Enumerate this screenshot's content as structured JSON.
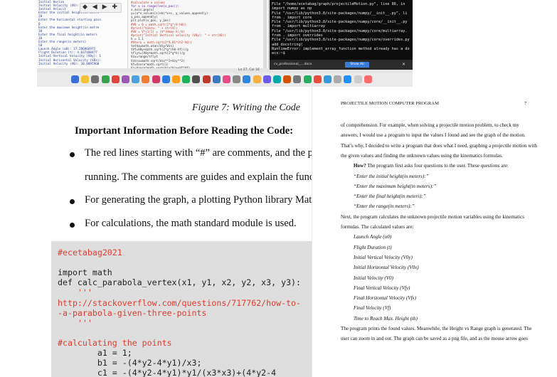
{
  "screenshot": {
    "ide_output_lines": [
      "Initial Horizo",
      "Initial Velocity (V0): Initial Velo",
      "Initial Velocit",
      "",
      "Enter the initial height(in metre",
      "20",
      "Enter the horizontal starting poin",
      "0",
      "Enter the maximum height(in metre",
      "30",
      "Enter the final height(in meters",
      "10",
      "Enter the range(in meters)",
      "50",
      "Launch Angle (α0): 37.286966971",
      "Flight Duration (t): 4.037408477",
      "Initial Vertical Velocity (V0y): 1",
      "Initial Horizontal Velocity (V0x):",
      "Initial Velocity (V0): 30.8095960"
    ],
    "ide_code_lines": [
      {
        "t": "#calculate a values",
        "k": "cm"
      },
      {
        "t": "for x in range(len(x_pos)):",
        "k": "kw"
      },
      {
        "t": "    x_axis.pop(x)",
        "k": ""
      },
      {
        "t": "    y=(a*x_values[x]+b)*x+c, y_values.append(y)",
        "k": ""
      },
      {
        "t": "",
        "k": ""
      },
      {
        "t": "    y_pos.append(y)",
        "k": ""
      },
      {
        "t": "plt.plot(x_pos, y_pos)",
        "k": ""
      },
      {
        "t": "#V0 = 0 = math.sqrt(2*g*(H-h0))",
        "k": "cm"
      },
      {
        "t": "#print(\"Vzero: \" + str(V))",
        "k": "cm"
      },
      {
        "t": "#V0 = V*(1/1) = (V*(Hmax-h)/h)",
        "k": "cm"
      },
      {
        "t": "#print(\"Initial Vertical velocity (V0y): \" + str(V0))",
        "k": "cm"
      },
      {
        "t": "h = 1.1",
        "k": ""
      },
      {
        "t": "#Vzero = math.sqrt(2*9.81*(h2-h0))",
        "k": "cm"
      },
      {
        "t": "tetha=math.atan(Vzy/Vzx)",
        "k": ""
      },
      {
        "t": "tVf=V0y+math.sqrt(2*g*(h0-hf))/g",
        "k": ""
      },
      {
        "t": "tflyt=(V0y+math.sqrt(2*g*h))/g",
        "k": ""
      },
      {
        "t": "Vzx=range/tflyt",
        "k": ""
      },
      {
        "t": "Vzero=math.sqrt(Vzx**2+Vzy**2)",
        "k": ""
      },
      {
        "t": "Vf=Vzero*math.sqrt(1)",
        "k": ""
      },
      {
        "t": "Vz=Vzero*math.sqrt(Vzx*Vzx+Vf*Vf)",
        "k": ""
      }
    ],
    "ide_nav_glyphs": "◆ ◀ ▶ ✚",
    "clock": "Ln 27, Col 16",
    "terminal_lines": [
      "File \"/home/ecetabag/graph/projectileMotion.py\", line 86, in",
      "  import numpy as np",
      "File \"/usr/lib/python3.8/site-packages/numpy/__init__.py\", li",
      "  from . import core",
      "File \"/usr/lib/python3.8/site-packages/numpy/core/__init__.py",
      "  from . import multiarray",
      "File \"/usr/lib/python3.8/site-packages/numpy/core/multiarray.",
      "  from . import overrides",
      "File \"/usr/lib/python3.8/site-packages/numpy/core/overrides.py",
      "  add_docstring(",
      "RuntimeError: implement_array_function method already has a do",
      "ecx:~$"
    ],
    "notification": {
      "file": "cv_professional_....docx",
      "button": "Show All",
      "close": "✕"
    },
    "dock_colors": [
      "#3b6fd8",
      "#f3c13a",
      "#6e6e6e",
      "#37a34a",
      "#e2423c",
      "#9b59b6",
      "#4aa3df",
      "#f07c2d",
      "#d03b6a",
      "#2d7be0",
      "#ff9f1a",
      "#1fb05a",
      "#505050",
      "#c0392b",
      "#3a78c3",
      "#e84a8a",
      "#888888",
      "#2e86de",
      "#f5b041",
      "#6c5ce7",
      "#00a8a8",
      "#d35400",
      "#777777",
      "#27ae60",
      "#e74c3c",
      "#3498db",
      "#aaaaaa",
      "#1e90ff",
      "#cccccc",
      "#ff6b6b"
    ]
  },
  "document": {
    "figure_caption": "Figure 7: Writing the Code",
    "section_heading": "Important Information Before Reading the Code:",
    "bullets": [
      "The red lines starting with “#” are comments, and the pro",
      "running. The comments are guides and explain the functio",
      "For generating the graph, a plotting Python library Matplo",
      "For calculations, the math standard module is used."
    ]
  },
  "code": {
    "lines": [
      {
        "t": "#ecetabag2021",
        "k": "c"
      },
      {
        "t": "",
        "k": ""
      },
      {
        "t": "import math",
        "k": ""
      },
      {
        "t": "def calc_parabola_vertex(x1, y1, x2, y2, x3, y3):",
        "k": ""
      },
      {
        "t": "    '''",
        "k": "c"
      },
      {
        "t": "http://stackoverflow.com/questions/717762/how-to-",
        "k": "c"
      },
      {
        "t": "-a-parabola-given-three-points",
        "k": "c"
      },
      {
        "t": "    '''",
        "k": "c"
      },
      {
        "t": "",
        "k": ""
      },
      {
        "t": "#calculating the points",
        "k": "c"
      },
      {
        "t": "        a1 = 1;",
        "k": ""
      },
      {
        "t": "        b1 = -(4*y2-4*y1)/x3;",
        "k": ""
      },
      {
        "t": "        c1 = -(4*y2-4*y1)*y1/(x3*x3)+(4*y2-4",
        "k": ""
      }
    ]
  },
  "paper": {
    "running_head": "PROJECTILE MOTION COMPUTER PROGRAM",
    "page_number": "7",
    "para1": [
      "of comprehension. For example, when solving a projectile motion problem, to check my",
      "answers, I would use a program to input the values I found and see the graph of the motion.",
      "That’s why, I decided to write a program that does what I need, graphing a projectile motion with",
      "the given values and finding the unknown values using the kinematics formulas."
    ],
    "how_bold": "How?",
    "how_rest": " The program first asks four questions to the user. These questions are:",
    "questions": [
      "“Enter the initial height(in meters):”",
      "“Enter the maximum height(in meters):”",
      "“Enter the final height(in meters):”",
      "“Enter the range(in meters):”"
    ],
    "para2": [
      "Next, the program calculates the unknown projectile motion variables using the kinematics",
      "formulas. The calculated values are:"
    ],
    "values": [
      "Launch Angle (α0)",
      "Flight Duration (t)",
      "Initial Vertical Velocity (V0y)",
      "Initial Horizontal Velocity (V0x)",
      "Initial Velocity (V0)",
      "Final Vertical Velocity (Vfy)",
      "Final Horizontal Velocity (Vfx)",
      "Final Velocity (Vf)",
      "Time to Reach Max. Height (th)"
    ],
    "para3": [
      "The program prints the found values. Meanwhile, the Height vs Range graph is generated. The",
      "user can zoom in and out. The graph can be saved as a png file, and as the mouse arrow goes"
    ]
  }
}
